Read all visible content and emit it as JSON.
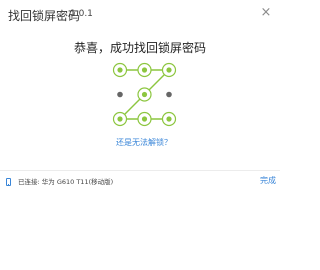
{
  "window": {
    "title": "找回锁屏密码",
    "version": "1.0.1",
    "close_icon": "×"
  },
  "main": {
    "heading": "恭喜，成功找回锁屏密码",
    "help_link": "还是无法解锁？"
  },
  "pattern": {
    "grid_size": 3,
    "active_dots": [
      1,
      2,
      3,
      5,
      7,
      8,
      9
    ],
    "sequence": [
      1,
      2,
      3,
      5,
      7,
      8,
      9
    ],
    "colors": {
      "active_fill": "#8cc63f",
      "active_ring": "#8cc63f",
      "inactive": "#666666",
      "line": "#8cc63f"
    }
  },
  "status_bar": {
    "icon": "phone-icon",
    "text": "已连接: 华为 G610 T11(移动版)",
    "finish_label": "完成"
  }
}
